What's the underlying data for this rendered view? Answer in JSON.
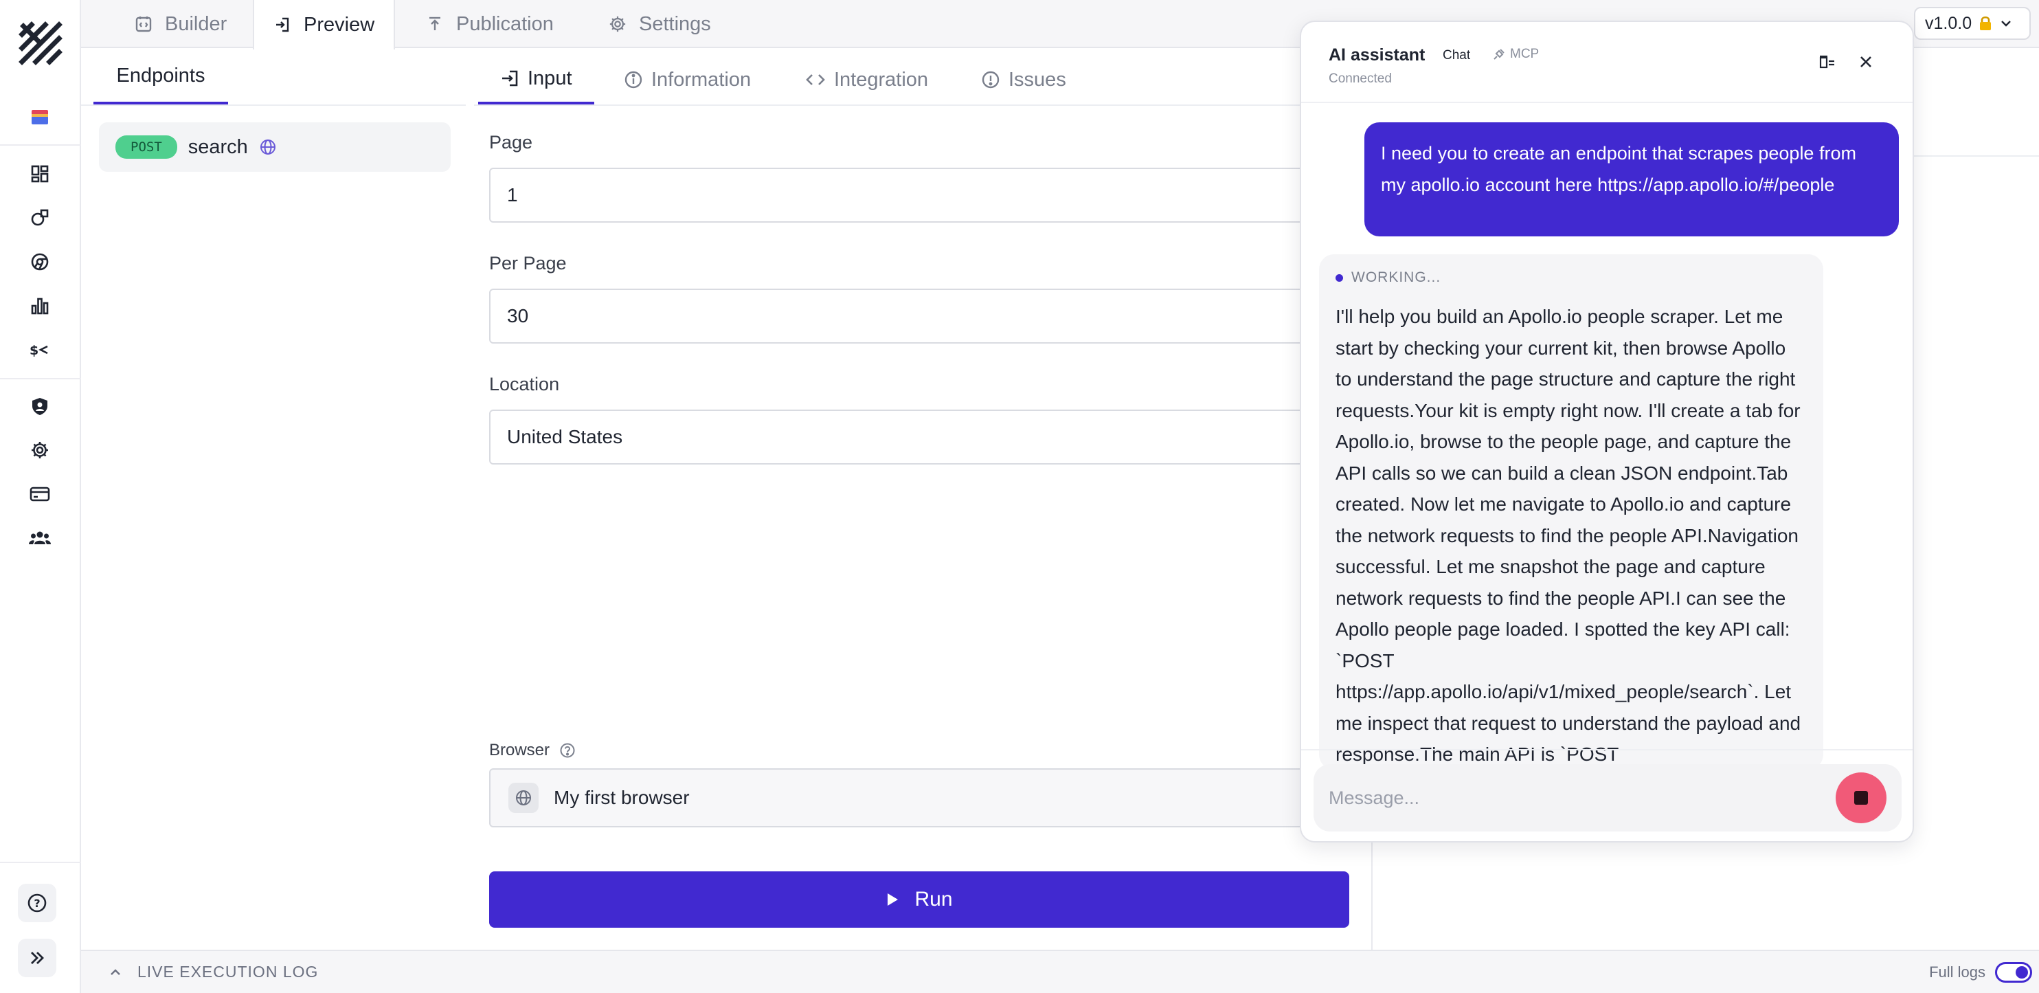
{
  "top_tabs": [
    {
      "label": "Builder",
      "icon": "builder-icon"
    },
    {
      "label": "Preview",
      "icon": "preview-icon"
    },
    {
      "label": "Publication",
      "icon": "publish-icon"
    },
    {
      "label": "Settings",
      "icon": "gear-icon"
    }
  ],
  "version": {
    "label": "v1.0.0"
  },
  "endpoints": {
    "tab_label": "Endpoints",
    "items": [
      {
        "method": "POST",
        "name": "search"
      }
    ]
  },
  "sub_tabs": [
    {
      "label": "Input",
      "icon": "input-icon"
    },
    {
      "label": "Information",
      "icon": "info-icon"
    },
    {
      "label": "Integration",
      "icon": "code-icon"
    },
    {
      "label": "Issues",
      "icon": "alert-icon"
    }
  ],
  "form": {
    "page": {
      "label": "Page",
      "value": "1"
    },
    "per_page": {
      "label": "Per Page",
      "value": "30"
    },
    "location": {
      "label": "Location",
      "value": "United States"
    },
    "browser": {
      "label": "Browser",
      "value": "My first browser"
    },
    "run_label": "Run"
  },
  "log": {
    "label": "LIVE EXECUTION LOG",
    "full_logs_label": "Full logs"
  },
  "ai": {
    "title": "AI assistant",
    "tab_chat": "Chat",
    "tab_mcp": "MCP",
    "status": "Connected",
    "user_message": "I need you to create an endpoint that scrapes people from my apollo.io account here https://app.apollo.io/#/people",
    "working_label": "WORKING...",
    "bot_message": "I'll help you build an Apollo.io people scraper. Let me start by checking your current kit, then browse Apollo to understand the page structure and capture the right requests.Your kit is empty right now. I'll create a tab for Apollo.io, browse to the people page, and capture the API calls so we can build a clean JSON endpoint.Tab created. Now let me navigate to Apollo.io and capture the network requests to find the people API.Navigation successful. Let me snapshot the page and capture network requests to find the people API.I can see the Apollo people page loaded. I spotted the key API call: `POST https://app.apollo.io/api/v1/mixed_people/search`. Let me inspect that request to understand the payload and response.The main API is `POST",
    "input_placeholder": "Message..."
  },
  "colors": {
    "accent": "#4129d0",
    "post_badge": "#4fcf8e",
    "stop_button": "#f15a78"
  }
}
